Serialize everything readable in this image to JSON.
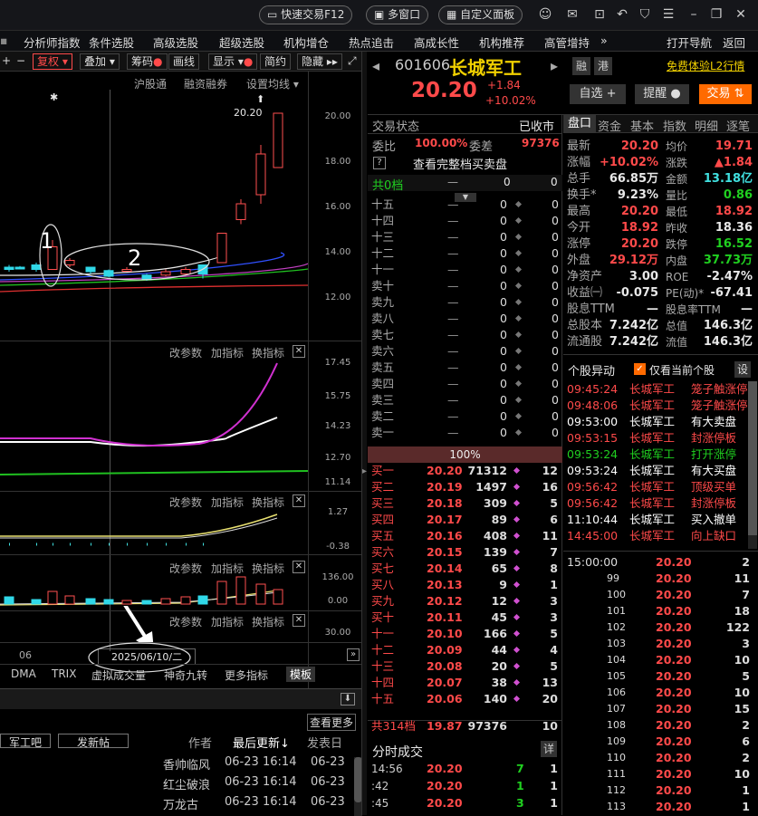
{
  "topbar": {
    "quick_trade": "快速交易F12",
    "multi_window": "多窗口",
    "custom_panel": "自定义面板"
  },
  "menu": [
    "分析师指数",
    "条件选股",
    "高级选股",
    "超级选股",
    "机构增仓",
    "热点追击",
    "高成长性",
    "机构推荐",
    "高管增持",
    "»",
    "打开导航",
    "返回"
  ],
  "toolbar": {
    "fuquan": "复权",
    "overlay": "叠加",
    "chips": "筹码",
    "lines": "画线",
    "display": "显示",
    "simple": "简约",
    "hide": "隐藏"
  },
  "chart": {
    "tabs": [
      "沪股通",
      "融资融券",
      "设置均线"
    ],
    "peak_label": "20.20",
    "star": "✱",
    "annot1": "1",
    "annot2": "2",
    "yaxis": [
      "20.00",
      "18.00",
      "16.00",
      "14.00",
      "12.00"
    ],
    "panel_tools": [
      "改参数",
      "加指标",
      "换指标"
    ],
    "macd_axis": [
      "17.45",
      "15.75",
      "14.23",
      "12.70",
      "11.14"
    ],
    "p3_axis": [
      "1.27",
      "-0.38"
    ],
    "p4_axis": [
      "136.00",
      "0.00"
    ],
    "p5_axis": [
      "30.00"
    ],
    "date_label": "2025/06/10/二",
    "date_left": "06",
    "bottom_tabs": [
      "DMA",
      "TRIX",
      "虚拟成交量",
      "神奇九转",
      "更多指标",
      "模板"
    ],
    "candles": [
      [
        10,
        13.4,
        13.3,
        13.5,
        13.2
      ],
      [
        22,
        13.4,
        13.35,
        13.45,
        13.3
      ],
      [
        40,
        13.5,
        13.3,
        13.6,
        13.2
      ],
      [
        58,
        13.3,
        14.3,
        14.6,
        13.3
      ],
      [
        77,
        13.5,
        13.7,
        13.8,
        13.4
      ],
      [
        100,
        13.4,
        13.2,
        13.4,
        13.1
      ],
      [
        120,
        13.25,
        13.0,
        13.3,
        12.95
      ],
      [
        140,
        13.3,
        13.3,
        13.4,
        13.2
      ],
      [
        162,
        13.05,
        12.85,
        13.1,
        12.8
      ],
      [
        183,
        13.05,
        13.2,
        13.3,
        13.0
      ],
      [
        205,
        13.1,
        13.3,
        13.4,
        13.1
      ],
      [
        224,
        13.5,
        13.1,
        13.5,
        12.9
      ],
      [
        245,
        13.6,
        14.9,
        14.9,
        13.6
      ],
      [
        266,
        15.5,
        16.2,
        16.4,
        15.3
      ],
      [
        288,
        16.6,
        18.4,
        18.8,
        16.2
      ],
      [
        307,
        17.8,
        20.2,
        20.2,
        17.8
      ]
    ],
    "vol_bars": [
      [
        10,
        8
      ],
      [
        40,
        5
      ],
      [
        58,
        14
      ],
      [
        77,
        9
      ],
      [
        100,
        6
      ],
      [
        120,
        5
      ],
      [
        140,
        4
      ],
      [
        162,
        4
      ],
      [
        183,
        6
      ],
      [
        205,
        8
      ],
      [
        224,
        9
      ],
      [
        245,
        25
      ],
      [
        266,
        30
      ],
      [
        288,
        22
      ],
      [
        307,
        16
      ]
    ]
  },
  "stock": {
    "code": "601606",
    "name": "长城军工",
    "price": "20.20",
    "change": "+1.84",
    "pct": "+10.02%",
    "tag1": "融",
    "tag2": "港",
    "l2": "免费体验L2行情",
    "self_select": "自选 +",
    "alert": "提醒",
    "trade": "交易"
  },
  "orderbook": {
    "status_label": "交易状态",
    "status": "已收市",
    "ratio_label": "委比",
    "ratio": "100.00%",
    "diff_label": "委差",
    "diff": "97376",
    "full_label": "查看完整档买卖盘",
    "top_label": "共0档",
    "top_a": "—",
    "top_b": "0",
    "top_c": "0",
    "sells": [
      "十五",
      "十四",
      "十三",
      "十二",
      "十一",
      "卖十",
      "卖九",
      "卖八",
      "卖七",
      "卖六",
      "卖五",
      "卖四",
      "卖三",
      "卖二",
      "卖一"
    ],
    "pct_bar": "100%",
    "buys": [
      [
        "买一",
        "20.20",
        "71312",
        "12"
      ],
      [
        "买二",
        "20.19",
        "1497",
        "16"
      ],
      [
        "买三",
        "20.18",
        "309",
        "5"
      ],
      [
        "买四",
        "20.17",
        "89",
        "6"
      ],
      [
        "买五",
        "20.16",
        "408",
        "11"
      ],
      [
        "买六",
        "20.15",
        "139",
        "7"
      ],
      [
        "买七",
        "20.14",
        "65",
        "8"
      ],
      [
        "买八",
        "20.13",
        "9",
        "1"
      ],
      [
        "买九",
        "20.12",
        "12",
        "3"
      ],
      [
        "买十",
        "20.11",
        "45",
        "3"
      ],
      [
        "十一",
        "20.10",
        "166",
        "5"
      ],
      [
        "十二",
        "20.09",
        "44",
        "4"
      ],
      [
        "十三",
        "20.08",
        "20",
        "5"
      ],
      [
        "十四",
        "20.07",
        "38",
        "13"
      ],
      [
        "十五",
        "20.06",
        "140",
        "20"
      ]
    ],
    "summary": [
      "共314档",
      "19.87",
      "97376",
      "10"
    ],
    "ticks_label": "分时成交",
    "detail": "详",
    "ticks": [
      [
        "14:56",
        "20.20",
        "7",
        "1"
      ],
      [
        ":42",
        "20.20",
        "1",
        "1"
      ],
      [
        ":45",
        "20.20",
        "3",
        "1"
      ]
    ]
  },
  "quote": {
    "tabs": [
      "盘口",
      "资金",
      "基本",
      "指数",
      "明细",
      "逐笔"
    ],
    "rows": [
      [
        "最新",
        "20.20",
        "均价",
        "19.71"
      ],
      [
        "涨幅",
        "+10.02%",
        "涨跌",
        "▲1.84"
      ],
      [
        "总手",
        "66.85万",
        "金额",
        "13.18亿"
      ],
      [
        "换手*",
        "9.23%",
        "量比",
        "0.86"
      ],
      [
        "最高",
        "20.20",
        "最低",
        "18.92"
      ],
      [
        "今开",
        "18.92",
        "昨收",
        "18.36"
      ],
      [
        "涨停",
        "20.20",
        "跌停",
        "16.52"
      ],
      [
        "外盘",
        "29.12万",
        "内盘",
        "37.73万"
      ],
      [
        "净资产",
        "3.00",
        "ROE",
        "-2.47%"
      ],
      [
        "收益㈠",
        "-0.075",
        "PE(动)*",
        "-67.41"
      ],
      [
        "股息TTM",
        "—",
        "股息率TTM",
        "—"
      ],
      [
        "总股本",
        "7.242亿",
        "总值",
        "146.3亿"
      ],
      [
        "流通股",
        "7.242亿",
        "流值",
        "146.3亿"
      ]
    ]
  },
  "events": {
    "title": "个股异动",
    "only_current": "仅看当前个股",
    "settings": "设",
    "items": [
      [
        "09:45:24",
        "长城军工",
        "笼子触涨停",
        "red"
      ],
      [
        "09:48:06",
        "长城军工",
        "笼子触涨停",
        "red"
      ],
      [
        "09:53:00",
        "长城军工",
        "有大卖盘",
        "white"
      ],
      [
        "09:53:15",
        "长城军工",
        "封涨停板",
        "red"
      ],
      [
        "09:53:24",
        "长城军工",
        "打开涨停",
        "green"
      ],
      [
        "09:53:24",
        "长城军工",
        "有大买盘",
        "white"
      ],
      [
        "09:56:42",
        "长城军工",
        "顶级买单",
        "red"
      ],
      [
        "09:56:42",
        "长城军工",
        "封涨停板",
        "red"
      ],
      [
        "11:10:44",
        "长城军工",
        "买入撤单",
        "white"
      ],
      [
        "14:45:00",
        "长城军工",
        "向上缺口",
        "red"
      ]
    ]
  },
  "trades": [
    [
      "15:00:00",
      "20.20",
      "2"
    ],
    [
      "99",
      "20.20",
      "11"
    ],
    [
      "100",
      "20.20",
      "7"
    ],
    [
      "101",
      "20.20",
      "18"
    ],
    [
      "102",
      "20.20",
      "122"
    ],
    [
      "103",
      "20.20",
      "3"
    ],
    [
      "104",
      "20.20",
      "10"
    ],
    [
      "105",
      "20.20",
      "5"
    ],
    [
      "106",
      "20.20",
      "10"
    ],
    [
      "107",
      "20.20",
      "15"
    ],
    [
      "108",
      "20.20",
      "2"
    ],
    [
      "109",
      "20.20",
      "6"
    ],
    [
      "110",
      "20.20",
      "2"
    ],
    [
      "111",
      "20.20",
      "10"
    ],
    [
      "112",
      "20.20",
      "1"
    ],
    [
      "113",
      "20.20",
      "1"
    ]
  ],
  "forum": {
    "check_more": "查看更多",
    "bar_btn": "军工吧",
    "post_btn": "发新帖",
    "col_author": "作者",
    "col_update": "最后更新",
    "col_post": "发表日",
    "rows": [
      [
        "香帅临风",
        "06-23",
        "16:14",
        "06-23"
      ],
      [
        "红尘破浪",
        "06-23",
        "16:14",
        "06-23"
      ],
      [
        "万龙古",
        "06-23",
        "16:14",
        "06-23"
      ]
    ]
  },
  "colors": {
    "up": "#ff4a4a",
    "down": "#20d020",
    "accent": "#ff6a00"
  }
}
